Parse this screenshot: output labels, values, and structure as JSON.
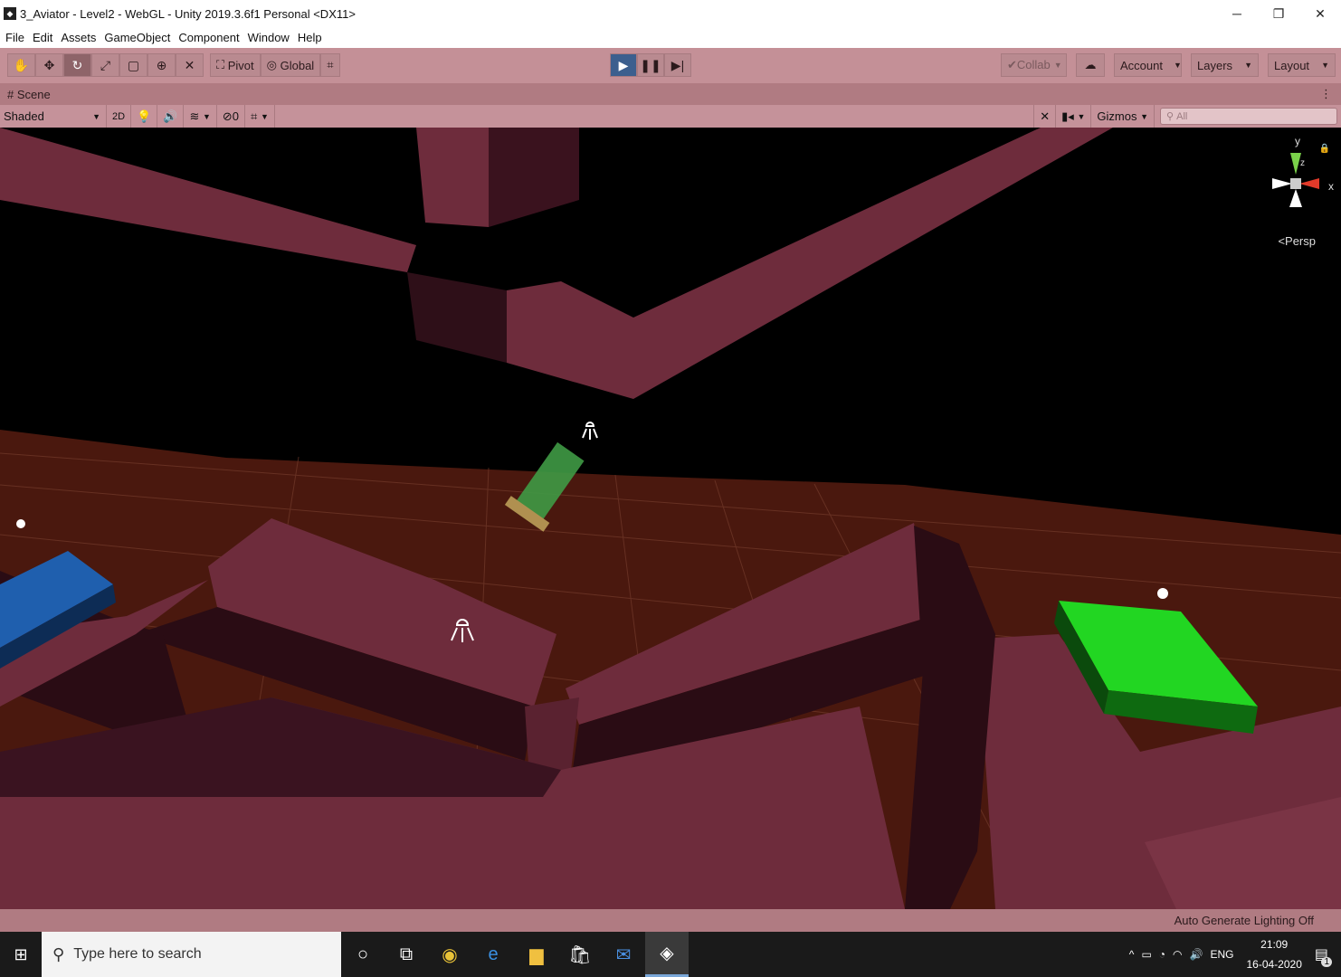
{
  "window": {
    "title": "3_Aviator - Level2 - WebGL - Unity 2019.3.6f1 Personal <DX11>",
    "minimize": "─",
    "maximize": "❐",
    "close": "✕"
  },
  "menu": [
    "File",
    "Edit",
    "Assets",
    "GameObject",
    "Component",
    "Window",
    "Help"
  ],
  "toolbar": {
    "pivot": "Pivot",
    "global": "Global",
    "collab": "Collab",
    "account": "Account",
    "layers": "Layers",
    "layout": "Layout"
  },
  "scene": {
    "tab_label": "Scene",
    "shading": "Shaded",
    "mode_2d": "2D",
    "hidden_count": "0",
    "gizmos": "Gizmos",
    "search_placeholder": "All",
    "persp": "Persp",
    "axis_x": "x",
    "axis_y": "y",
    "axis_z": "z"
  },
  "status": {
    "lighting": "Auto Generate Lighting Off"
  },
  "taskbar": {
    "search_placeholder": "Type here to search",
    "language": "ENG",
    "time": "21:09",
    "date": "16-04-2020",
    "notification_count": "1"
  },
  "colors": {
    "toolbar_bg": "#c49097",
    "scene_tab_bg": "#b07b82",
    "wall": "#6e2c3c",
    "floor": "#4a180e",
    "blue_pad": "#1f5fae",
    "green_pad": "#22d622",
    "player": "#3f9a45"
  }
}
